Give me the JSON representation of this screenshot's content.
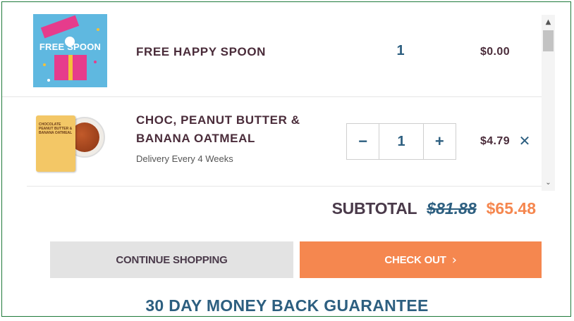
{
  "cart": {
    "items": [
      {
        "thumbnail_text": "FREE SPOON",
        "name": "FREE HAPPY SPOON",
        "quantity": "1",
        "price": "$0.00"
      },
      {
        "thumbnail_text": "CHOCOLATE PEANUT BUTTER & BANANA OATMEAL",
        "name": "CHOC, PEANUT BUTTER & BANANA OATMEAL",
        "subtext": "Delivery Every 4 Weeks",
        "quantity": "1",
        "decrement_label": "−",
        "increment_label": "+",
        "price": "$4.79",
        "remove_icon": "close-icon"
      }
    ]
  },
  "scrollbar": {
    "up_arrow": "▲",
    "down_arrow": "⌄"
  },
  "summary": {
    "subtotal_label": "SUBTOTAL",
    "original_total": "$81.88",
    "discounted_total": "$65.48"
  },
  "actions": {
    "continue_label": "CONTINUE SHOPPING",
    "checkout_label": "CHECK OUT",
    "checkout_chevron": "›"
  },
  "guarantee_text": "30 DAY MONEY BACK GUARANTEE",
  "colors": {
    "accent_orange": "#f5874f",
    "accent_blue": "#2d5f80",
    "text_dark": "#4a2c3a",
    "frame_border": "#1f7a3a"
  }
}
